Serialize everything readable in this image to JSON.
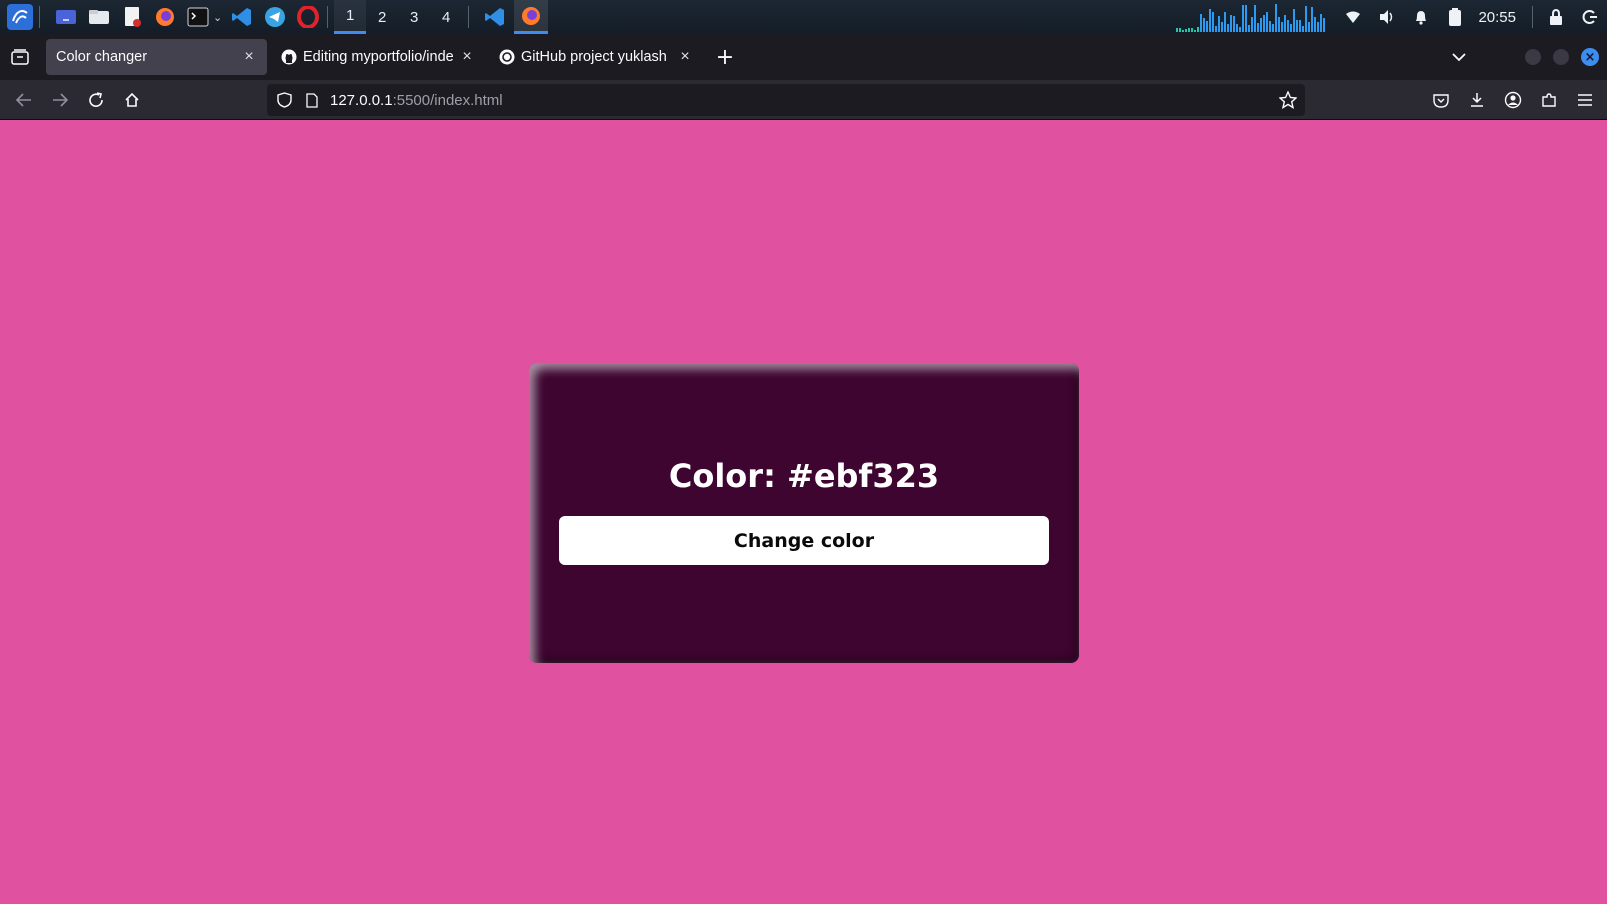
{
  "taskbar": {
    "workspaces": [
      "1",
      "2",
      "3",
      "4"
    ],
    "active_workspace": "1",
    "clock": "20:55",
    "graph_color": "#2a9bf0"
  },
  "browser": {
    "tabs": [
      {
        "title": "Color changer",
        "active": true,
        "icon": "none"
      },
      {
        "title": "Editing myportfolio/index",
        "active": false,
        "icon": "github-icon"
      },
      {
        "title": "GitHub project yuklash",
        "active": false,
        "icon": "openai-icon"
      }
    ],
    "url_host": "127.0.0.1",
    "url_path": ":5500/index.html"
  },
  "page": {
    "background_color": "#e052a0",
    "card_color": "#3d0530",
    "color_label": "Color: #ebf323",
    "button_label": "Change color"
  }
}
